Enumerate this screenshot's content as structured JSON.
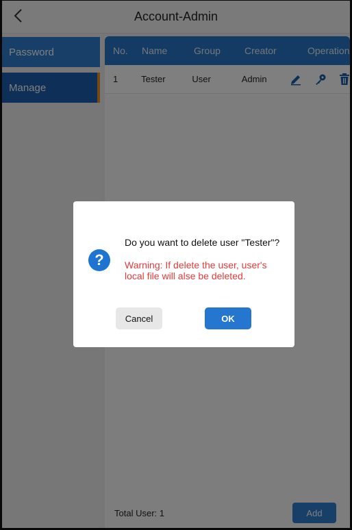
{
  "header": {
    "title": "Account-Admin"
  },
  "sidebar": {
    "items": [
      {
        "label": "Password"
      },
      {
        "label": "Manage"
      }
    ]
  },
  "table": {
    "columns": [
      "No.",
      "Name",
      "Group",
      "Creator",
      "Operation"
    ],
    "rows": [
      {
        "no": "1",
        "name": "Tester",
        "group": "User",
        "creator": "Admin"
      }
    ]
  },
  "footer": {
    "total_label": "Total User: 1",
    "add_label": "Add"
  },
  "dialog": {
    "message": "Do you want to delete user \"Tester\"?",
    "warning": "Warning: If delete the user, user's local file will alse be deleted.",
    "icon": "question-icon",
    "cancel_label": "Cancel",
    "ok_label": "OK"
  },
  "colors": {
    "accent": "#2876c6",
    "warning": "#e53a3a",
    "selected_indicator": "#e8922a"
  }
}
